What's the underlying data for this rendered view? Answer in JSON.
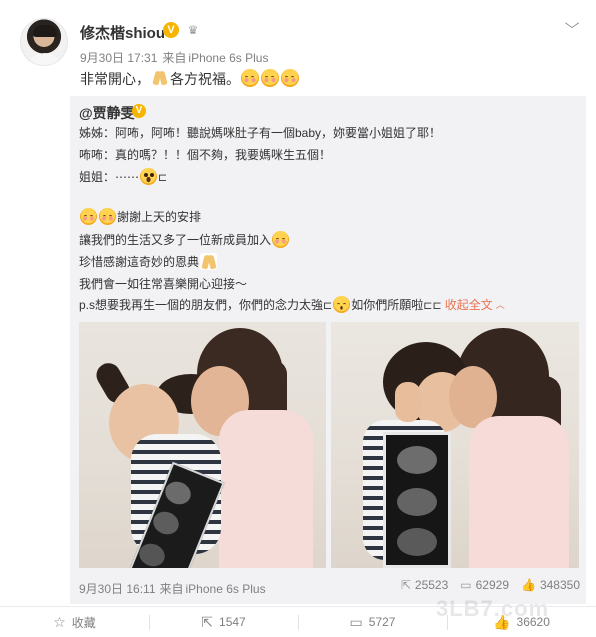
{
  "user": {
    "name": "修杰楷shiou",
    "verified_mark": "V",
    "timestamp": "9月30日 17:31",
    "source_prefix": "来自",
    "device": "iPhone 6s Plus",
    "text_a": "非常開心，",
    "text_b": "各方祝福。"
  },
  "repost": {
    "author": "@贾静雯",
    "verified_mark": "V",
    "lines": [
      "姊姊：阿咘，阿咘！聽說媽咪肚子有一個baby，妳要當小姐姐了耶！",
      "咘咘：真的嗎？！！個不夠，我要媽咪生五個！",
      "姐姐：⋯⋯",
      "謝謝上天的安排",
      "讓我們的生活又多了一位新成員加入",
      "珍惜感謝這奇妙的恩典",
      "我們會一如往常喜樂開心迎接～",
      "p.s想要我再生一個的朋友們，你們的念力太強",
      "如你們所願啦"
    ],
    "expand_label": "收起全文",
    "timestamp": "9月30日 16:11",
    "source_prefix": "来自",
    "device": "iPhone 6s Plus",
    "stats": [
      "25523",
      "62929",
      "348350"
    ],
    "watermark": "3LB7.com"
  },
  "actions": {
    "favorite": "收藏",
    "repost": "1547",
    "comment": "5727",
    "like": "36620"
  },
  "icons": {
    "more": "chevron-down-icon",
    "crown": "crown-icon",
    "favorite": "star-icon",
    "repost": "repost-icon",
    "comment": "comment-icon",
    "like": "thumbs-up-icon"
  },
  "colors": {
    "accent": "#eb7350",
    "verified": "#f7b500",
    "repost_bg": "#f2f2f5",
    "meta_text": "#808080"
  }
}
